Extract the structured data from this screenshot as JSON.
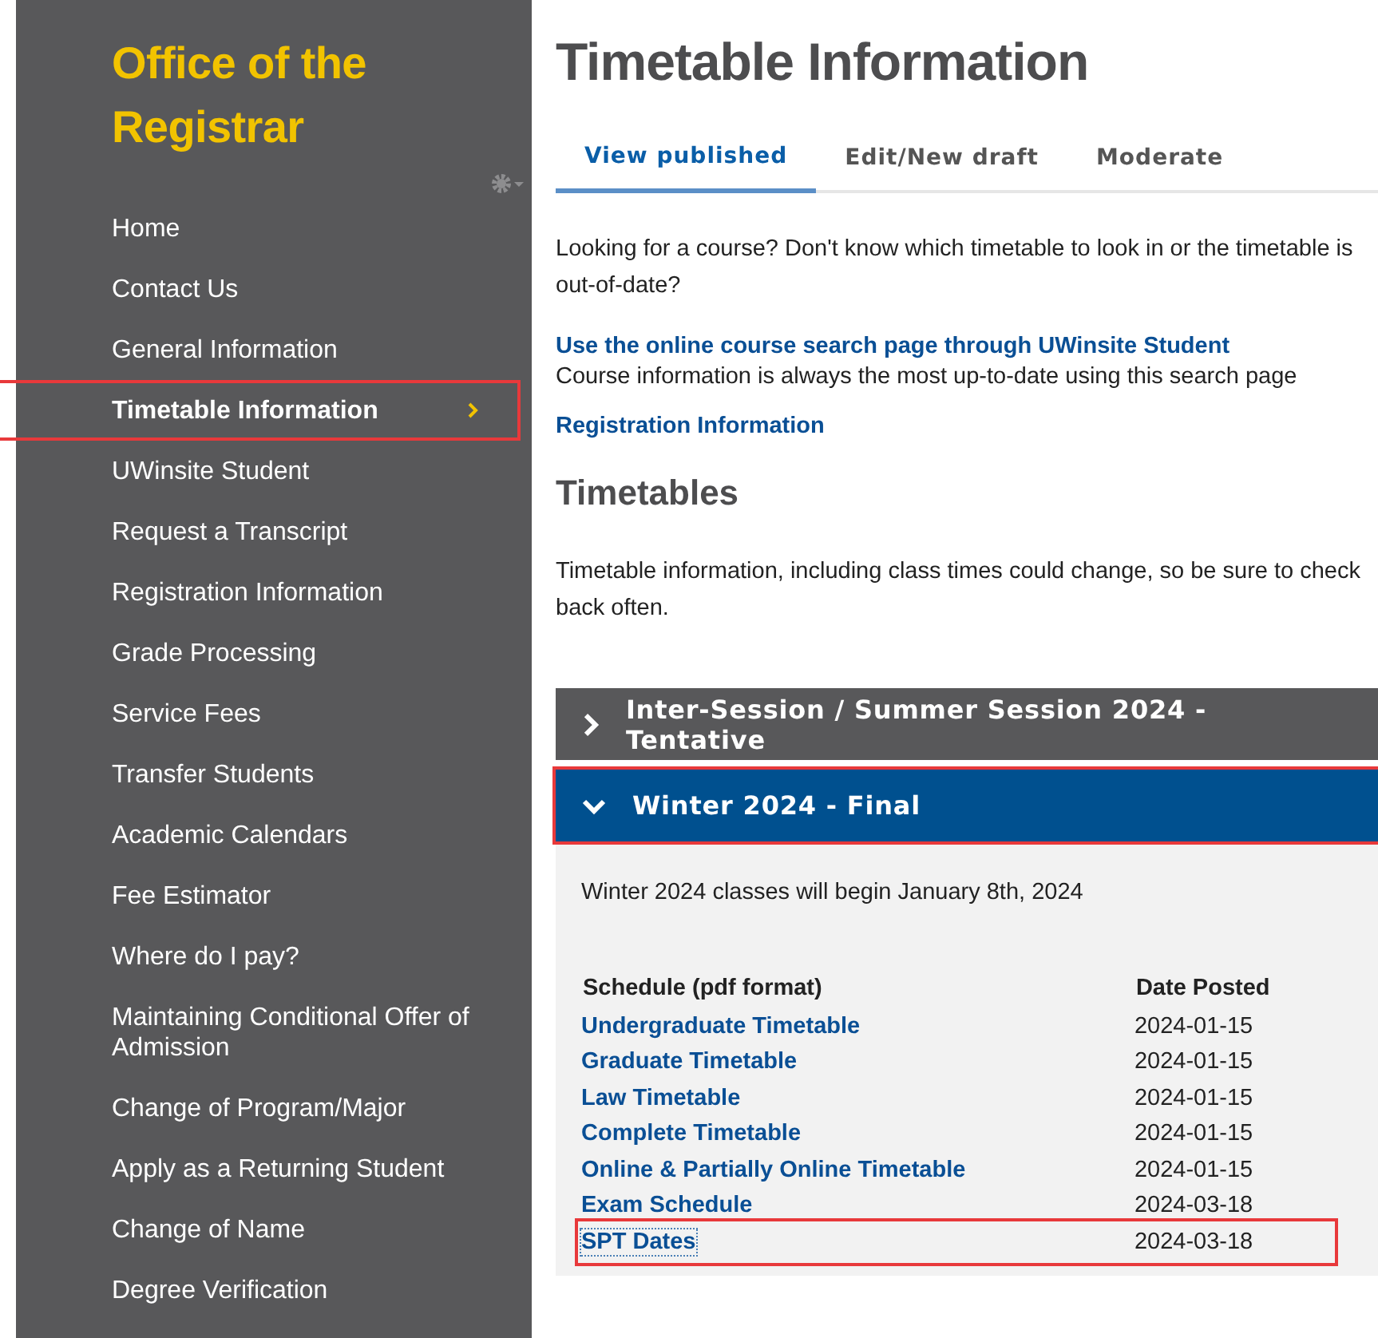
{
  "sidebar": {
    "title": "Office of the Registrar",
    "items": [
      {
        "label": "Home",
        "selected": false,
        "highlighted": false
      },
      {
        "label": "Contact Us",
        "selected": false,
        "highlighted": false
      },
      {
        "label": "General Information",
        "selected": false,
        "highlighted": false
      },
      {
        "label": "Timetable Information",
        "selected": true,
        "highlighted": true
      },
      {
        "label": "UWinsite Student",
        "selected": false,
        "highlighted": false
      },
      {
        "label": "Request a Transcript",
        "selected": false,
        "highlighted": false
      },
      {
        "label": "Registration Information",
        "selected": false,
        "highlighted": false
      },
      {
        "label": "Grade Processing",
        "selected": false,
        "highlighted": false
      },
      {
        "label": "Service Fees",
        "selected": false,
        "highlighted": false
      },
      {
        "label": "Transfer Students",
        "selected": false,
        "highlighted": false
      },
      {
        "label": "Academic Calendars",
        "selected": false,
        "highlighted": false
      },
      {
        "label": "Fee Estimator",
        "selected": false,
        "highlighted": false
      },
      {
        "label": "Where do I pay?",
        "selected": false,
        "highlighted": false
      },
      {
        "label": "Maintaining Conditional Offer of Admission",
        "selected": false,
        "highlighted": false
      },
      {
        "label": "Change of Program/Major",
        "selected": false,
        "highlighted": false
      },
      {
        "label": "Apply as a Returning Student",
        "selected": false,
        "highlighted": false
      },
      {
        "label": "Change of Name",
        "selected": false,
        "highlighted": false
      },
      {
        "label": "Degree Verification",
        "selected": false,
        "highlighted": false
      }
    ]
  },
  "page_title": "Timetable Information",
  "tabs": [
    {
      "label": "View published",
      "selected": true
    },
    {
      "label": "Edit/New draft",
      "selected": false
    },
    {
      "label": "Moderate",
      "selected": false
    }
  ],
  "intro": "Looking for a course? Don't know which timetable to look in or the timetable is out-of-date?",
  "search_link": "Use the online course search page through UWinsite Student",
  "search_note": "Course information is always the most up-to-date using this search page",
  "registration_link": "Registration Information",
  "timetables_heading": "Timetables",
  "timetables_note": "Timetable information, including class times could change, so be sure to check back often.",
  "accordion": [
    {
      "title": "Inter-Session / Summer Session 2024 - Tentative",
      "expanded": false,
      "highlighted": false
    },
    {
      "title": "Winter 2024 - Final",
      "expanded": true,
      "highlighted": true,
      "note": "Winter 2024 classes will begin January 8th, 2024",
      "columns": [
        "Schedule (pdf format)",
        "Date Posted"
      ],
      "rows": [
        {
          "name": "Undergraduate Timetable",
          "date": "2024-01-15",
          "highlighted": false
        },
        {
          "name": "Graduate Timetable",
          "date": "2024-01-15",
          "highlighted": false
        },
        {
          "name": "Law Timetable",
          "date": "2024-01-15",
          "highlighted": false
        },
        {
          "name": "Complete Timetable",
          "date": "2024-01-15",
          "highlighted": false
        },
        {
          "name": "Online & Partially Online Timetable",
          "date": "2024-01-15",
          "highlighted": false
        },
        {
          "name": "Exam Schedule",
          "date": "2024-03-18",
          "highlighted": false
        },
        {
          "name": "SPT Dates",
          "date": "2024-03-18",
          "highlighted": true
        }
      ]
    }
  ]
}
